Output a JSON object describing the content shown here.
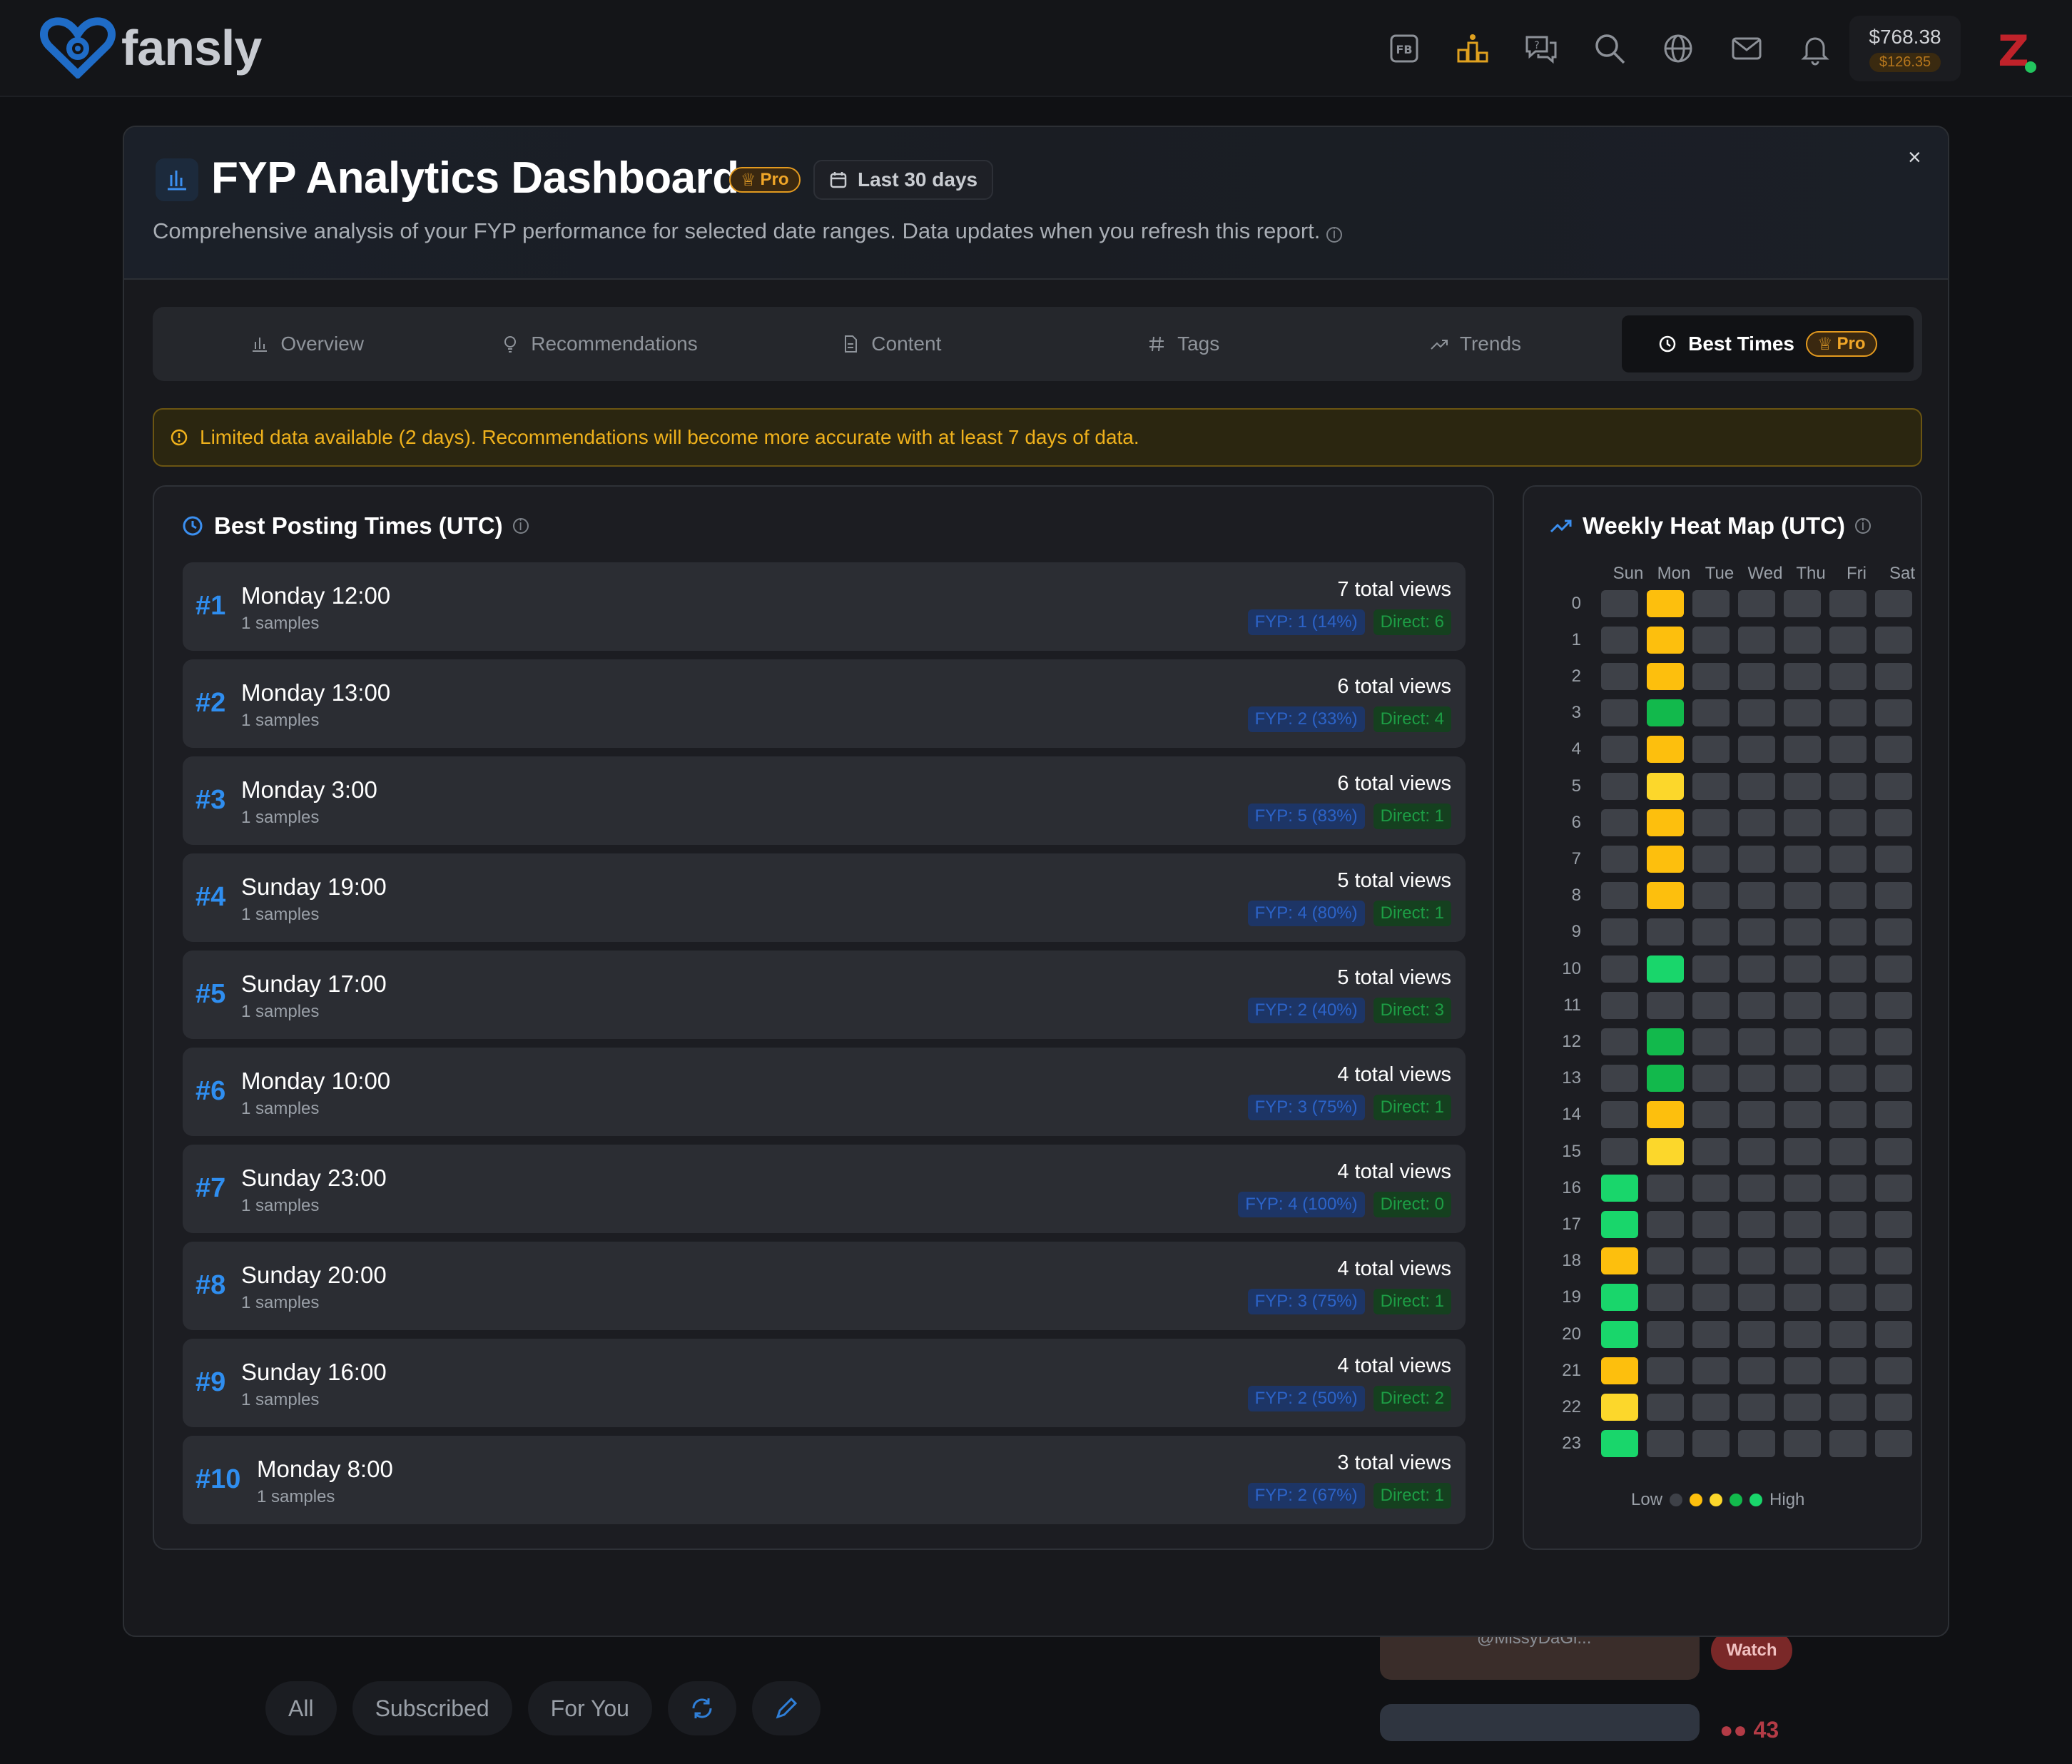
{
  "nav": {
    "logo_text": "fansly",
    "wallet_balance": "$768.38",
    "wallet_pending": "$126.35",
    "avatar_letter": "Z",
    "icons": [
      "fb-icon",
      "leaderboard-icon",
      "help-chat-icon",
      "search-icon",
      "globe-icon",
      "mail-icon",
      "bell-icon"
    ]
  },
  "background": {
    "filters": [
      "All",
      "Subscribed",
      "For You"
    ],
    "handle": "@MissyDaGi...",
    "watch_label": "Watch",
    "viewer_count": "43"
  },
  "modal": {
    "title": "FYP Analytics Dashboard",
    "pro_label": "Pro",
    "date_range": "Last 30 days",
    "description": "Comprehensive analysis of your FYP performance for selected date ranges. Data updates when you refresh this report.",
    "close_label": "×",
    "tabs": [
      {
        "label": "Overview",
        "icon": "bar-chart-icon"
      },
      {
        "label": "Recommendations",
        "icon": "lightbulb-icon"
      },
      {
        "label": "Content",
        "icon": "document-icon"
      },
      {
        "label": "Tags",
        "icon": "hash-icon"
      },
      {
        "label": "Trends",
        "icon": "trend-icon"
      },
      {
        "label": "Best Times",
        "icon": "clock-icon",
        "badge": "Pro",
        "active": true
      }
    ],
    "warning": "Limited data available (2 days). Recommendations will become more accurate with at least 7 days of data."
  },
  "best_times": {
    "title": "Best Posting Times (UTC)",
    "rows": [
      {
        "rank": "#1",
        "time": "Monday 12:00",
        "samples": "1 samples",
        "views": "7 total views",
        "fyp": "FYP: 1 (14%)",
        "direct": "Direct: 6"
      },
      {
        "rank": "#2",
        "time": "Monday 13:00",
        "samples": "1 samples",
        "views": "6 total views",
        "fyp": "FYP: 2 (33%)",
        "direct": "Direct: 4"
      },
      {
        "rank": "#3",
        "time": "Monday 3:00",
        "samples": "1 samples",
        "views": "6 total views",
        "fyp": "FYP: 5 (83%)",
        "direct": "Direct: 1"
      },
      {
        "rank": "#4",
        "time": "Sunday 19:00",
        "samples": "1 samples",
        "views": "5 total views",
        "fyp": "FYP: 4 (80%)",
        "direct": "Direct: 1"
      },
      {
        "rank": "#5",
        "time": "Sunday 17:00",
        "samples": "1 samples",
        "views": "5 total views",
        "fyp": "FYP: 2 (40%)",
        "direct": "Direct: 3"
      },
      {
        "rank": "#6",
        "time": "Monday 10:00",
        "samples": "1 samples",
        "views": "4 total views",
        "fyp": "FYP: 3 (75%)",
        "direct": "Direct: 1"
      },
      {
        "rank": "#7",
        "time": "Sunday 23:00",
        "samples": "1 samples",
        "views": "4 total views",
        "fyp": "FYP: 4 (100%)",
        "direct": "Direct: 0"
      },
      {
        "rank": "#8",
        "time": "Sunday 20:00",
        "samples": "1 samples",
        "views": "4 total views",
        "fyp": "FYP: 3 (75%)",
        "direct": "Direct: 1"
      },
      {
        "rank": "#9",
        "time": "Sunday 16:00",
        "samples": "1 samples",
        "views": "4 total views",
        "fyp": "FYP: 2 (50%)",
        "direct": "Direct: 2"
      },
      {
        "rank": "#10",
        "time": "Monday 8:00",
        "samples": "1 samples",
        "views": "3 total views",
        "fyp": "FYP: 2 (67%)",
        "direct": "Direct: 1"
      }
    ]
  },
  "heatmap": {
    "title": "Weekly Heat Map (UTC)",
    "days": [
      "Sun",
      "Mon",
      "Tue",
      "Wed",
      "Thu",
      "Fri",
      "Sat"
    ],
    "hours": [
      "0",
      "1",
      "2",
      "3",
      "4",
      "5",
      "6",
      "7",
      "8",
      "9",
      "10",
      "11",
      "12",
      "13",
      "14",
      "15",
      "16",
      "17",
      "18",
      "19",
      "20",
      "21",
      "22",
      "23"
    ],
    "legend_low": "Low",
    "legend_high": "High",
    "level_colors": {
      "empty": "#3e4148",
      "amber": "#fdbf0d",
      "yellow": "#fcd72b",
      "green": "#12b94c",
      "lgreen": "#19d66b"
    },
    "cells": [
      [
        "empty",
        "amber",
        "empty",
        "empty",
        "empty",
        "empty",
        "empty"
      ],
      [
        "empty",
        "amber",
        "empty",
        "empty",
        "empty",
        "empty",
        "empty"
      ],
      [
        "empty",
        "amber",
        "empty",
        "empty",
        "empty",
        "empty",
        "empty"
      ],
      [
        "empty",
        "green",
        "empty",
        "empty",
        "empty",
        "empty",
        "empty"
      ],
      [
        "empty",
        "amber",
        "empty",
        "empty",
        "empty",
        "empty",
        "empty"
      ],
      [
        "empty",
        "yellow",
        "empty",
        "empty",
        "empty",
        "empty",
        "empty"
      ],
      [
        "empty",
        "amber",
        "empty",
        "empty",
        "empty",
        "empty",
        "empty"
      ],
      [
        "empty",
        "amber",
        "empty",
        "empty",
        "empty",
        "empty",
        "empty"
      ],
      [
        "empty",
        "amber",
        "empty",
        "empty",
        "empty",
        "empty",
        "empty"
      ],
      [
        "empty",
        "empty",
        "empty",
        "empty",
        "empty",
        "empty",
        "empty"
      ],
      [
        "empty",
        "lgreen",
        "empty",
        "empty",
        "empty",
        "empty",
        "empty"
      ],
      [
        "empty",
        "empty",
        "empty",
        "empty",
        "empty",
        "empty",
        "empty"
      ],
      [
        "empty",
        "green",
        "empty",
        "empty",
        "empty",
        "empty",
        "empty"
      ],
      [
        "empty",
        "green",
        "empty",
        "empty",
        "empty",
        "empty",
        "empty"
      ],
      [
        "empty",
        "amber",
        "empty",
        "empty",
        "empty",
        "empty",
        "empty"
      ],
      [
        "empty",
        "yellow",
        "empty",
        "empty",
        "empty",
        "empty",
        "empty"
      ],
      [
        "lgreen",
        "empty",
        "empty",
        "empty",
        "empty",
        "empty",
        "empty"
      ],
      [
        "lgreen",
        "empty",
        "empty",
        "empty",
        "empty",
        "empty",
        "empty"
      ],
      [
        "amber",
        "empty",
        "empty",
        "empty",
        "empty",
        "empty",
        "empty"
      ],
      [
        "lgreen",
        "empty",
        "empty",
        "empty",
        "empty",
        "empty",
        "empty"
      ],
      [
        "lgreen",
        "empty",
        "empty",
        "empty",
        "empty",
        "empty",
        "empty"
      ],
      [
        "amber",
        "empty",
        "empty",
        "empty",
        "empty",
        "empty",
        "empty"
      ],
      [
        "yellow",
        "empty",
        "empty",
        "empty",
        "empty",
        "empty",
        "empty"
      ],
      [
        "lgreen",
        "empty",
        "empty",
        "empty",
        "empty",
        "empty",
        "empty"
      ]
    ]
  }
}
